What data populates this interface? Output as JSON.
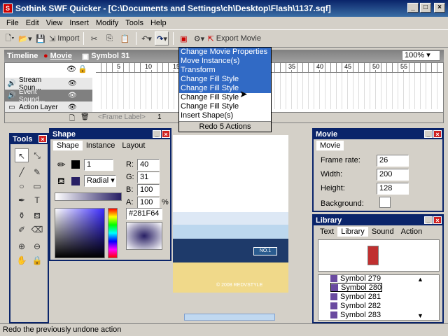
{
  "window": {
    "title": "Sothink SWF Quicker - [C:\\Documents and Settings\\ch\\Desktop\\Flash\\1137.sqf]"
  },
  "menu": [
    "File",
    "Edit",
    "View",
    "Insert",
    "Modify",
    "Tools",
    "Help"
  ],
  "toolbar": {
    "import_label": "Import",
    "export_label": "Export Movie"
  },
  "timeline": {
    "title": "Timeline",
    "movie_link": "Movie",
    "symbol": "Symbol 31",
    "zoom": "100%",
    "layers": [
      "Stream Soun...",
      "Event Sound...",
      "Action Layer"
    ],
    "ruler": [
      "5",
      "10",
      "15",
      "35",
      "40",
      "45",
      "50",
      "55"
    ],
    "frame_label": "<Frame Label>",
    "frame_num": "1"
  },
  "redo_menu": {
    "items": [
      "Change Movie Properties",
      "Move Instance(s)",
      "Transform",
      "Change Fill Style",
      "Change Fill Style",
      "Change Fill Style",
      "Change Fill Style",
      "Insert Shape(s)"
    ],
    "footer": "Redo 5 Actions"
  },
  "tools_panel": {
    "title": "Tools"
  },
  "shape_panel": {
    "title": "Shape",
    "tabs": [
      "Shape",
      "Instance",
      "Layout"
    ],
    "line_width": "1",
    "fill_type": "Radial",
    "r_label": "R:",
    "g_label": "G:",
    "b_label": "B:",
    "a_label": "A:",
    "r": "40",
    "g": "31",
    "b": "100",
    "a": "100",
    "pct": "%",
    "hex": "#281F64"
  },
  "movie_panel": {
    "title": "Movie",
    "tab": "Movie",
    "frame_rate_label": "Frame rate:",
    "frame_rate": "26",
    "width_label": "Width:",
    "width": "200",
    "height_label": "Height:",
    "height": "128",
    "background_label": "Background:"
  },
  "library_panel": {
    "title": "Library",
    "tabs": [
      "Text",
      "Library",
      "Sound",
      "Action"
    ],
    "items": [
      "Symbol 279",
      "Symbol 280",
      "Symbol 281",
      "Symbol 282",
      "Symbol 283"
    ]
  },
  "stage": {
    "sign_text": "NO.1",
    "footer_text": "© 2008 REDVSTYLE"
  },
  "status": {
    "text": "Redo the previously undone action"
  },
  "colors": {
    "accent": "#0a246a",
    "highlight": "#316ac5",
    "fill": "#281F64"
  }
}
